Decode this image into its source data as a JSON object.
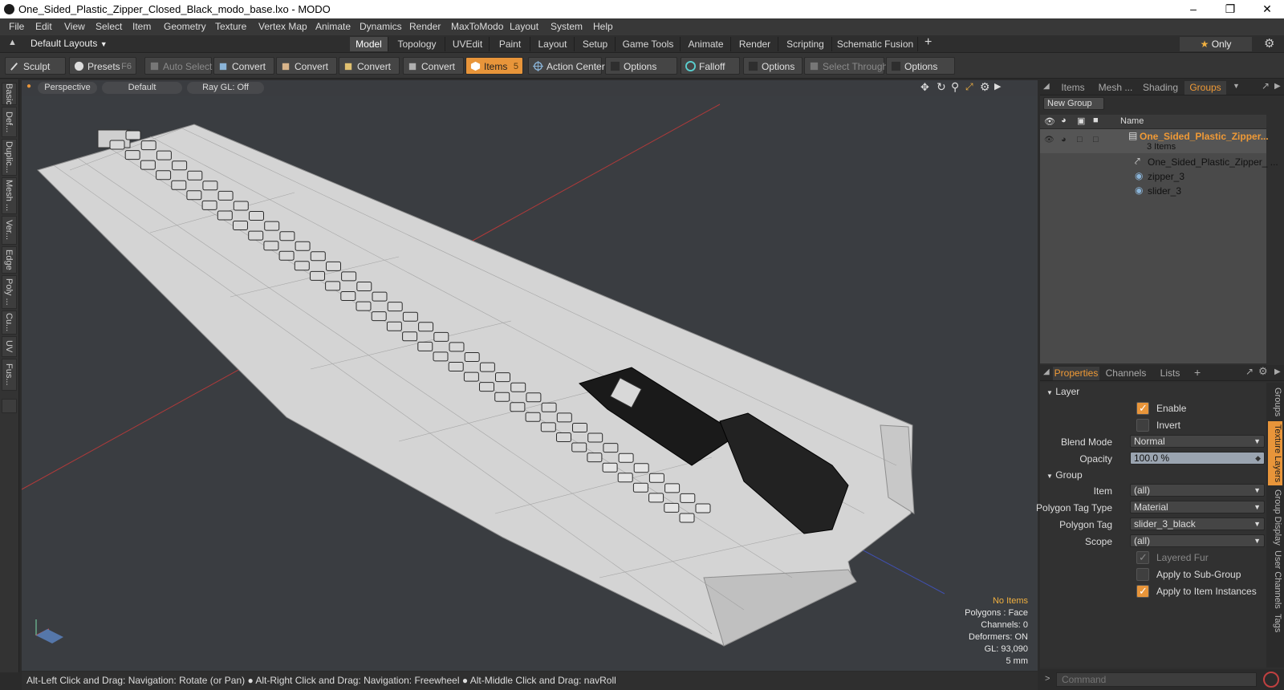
{
  "window": {
    "title": "One_Sided_Plastic_Zipper_Closed_Black_modo_base.lxo - MODO"
  },
  "menu": [
    "File",
    "Edit",
    "View",
    "Select",
    "Item",
    "Geometry",
    "Texture",
    "Vertex Map",
    "Animate",
    "Dynamics",
    "Render",
    "MaxToModo",
    "Layout",
    "System",
    "Help"
  ],
  "layouts": {
    "default_label": "Default Layouts",
    "tabs": [
      "Model",
      "Topology",
      "UVEdit",
      "Paint",
      "Layout",
      "Setup",
      "Game Tools",
      "Animate",
      "Render",
      "Scripting",
      "Schematic Fusion"
    ],
    "active_tab": "Model",
    "add": "+",
    "only_label": "Only"
  },
  "toolbar": {
    "sculpt": "Sculpt",
    "presets": "Presets",
    "presets_key": "F6",
    "auto_select": "Auto Select",
    "convert1": "Convert",
    "convert2": "Convert",
    "convert3": "Convert",
    "convert4": "Convert",
    "items": "Items",
    "items_key": "5",
    "action_center": "Action Center",
    "options1": "Options",
    "falloff": "Falloff",
    "options2": "Options",
    "select_through": "Select Through",
    "options3": "Options"
  },
  "left_tabs": [
    "Basic",
    "Def...",
    "Duplic...",
    "Mesh ...",
    "Ver...",
    "Edge",
    "Poly ...",
    "Cu...",
    "UV",
    "Fus..."
  ],
  "viewport": {
    "view": "Perspective",
    "shading": "Default",
    "raygl": "Ray GL: Off",
    "hud": {
      "items": "No Items",
      "polygons": "Polygons : Face",
      "channels": "Channels: 0",
      "deformers": "Deformers: ON",
      "gl": "GL: 93,090",
      "scale": "5 mm"
    }
  },
  "status": "Alt-Left Click and Drag: Navigation: Rotate (or Pan) ● Alt-Right Click and Drag: Navigation: Freewheel ● Alt-Middle Click and Drag: navRoll",
  "right_tabs": [
    "Items",
    "Mesh ...",
    "Shading",
    "Groups"
  ],
  "groups": {
    "new_group": "New Group",
    "name_col": "Name",
    "root_name": "One_Sided_Plastic_Zipper...",
    "root_count": "3 Items",
    "children": [
      "One_Sided_Plastic_Zipper_ ...",
      "zipper_3",
      "slider_3"
    ]
  },
  "prop_tabs": [
    "Properties",
    "Channels",
    "Lists"
  ],
  "props": {
    "layer_section": "Layer",
    "enable": "Enable",
    "invert": "Invert",
    "blend_label": "Blend Mode",
    "blend_value": "Normal",
    "opacity_label": "Opacity",
    "opacity_value": "100.0 %",
    "group_section": "Group",
    "item_label": "Item",
    "item_value": "(all)",
    "ptt_label": "Polygon Tag Type",
    "ptt_value": "Material",
    "pt_label": "Polygon Tag",
    "pt_value": "slider_3_black",
    "scope_label": "Scope",
    "scope_value": "(all)",
    "layered_fur": "Layered Fur",
    "apply_sub": "Apply to Sub-Group",
    "apply_inst": "Apply to Item Instances"
  },
  "side_tabs": [
    "Groups",
    "Texture Layers",
    "Group Display",
    "User Channels",
    "Tags"
  ],
  "command": {
    "placeholder": "Command"
  },
  "colors": {
    "accent": "#e8953a",
    "viewport_bg": "#3a3d41",
    "hud_warn": "#f0b040"
  }
}
